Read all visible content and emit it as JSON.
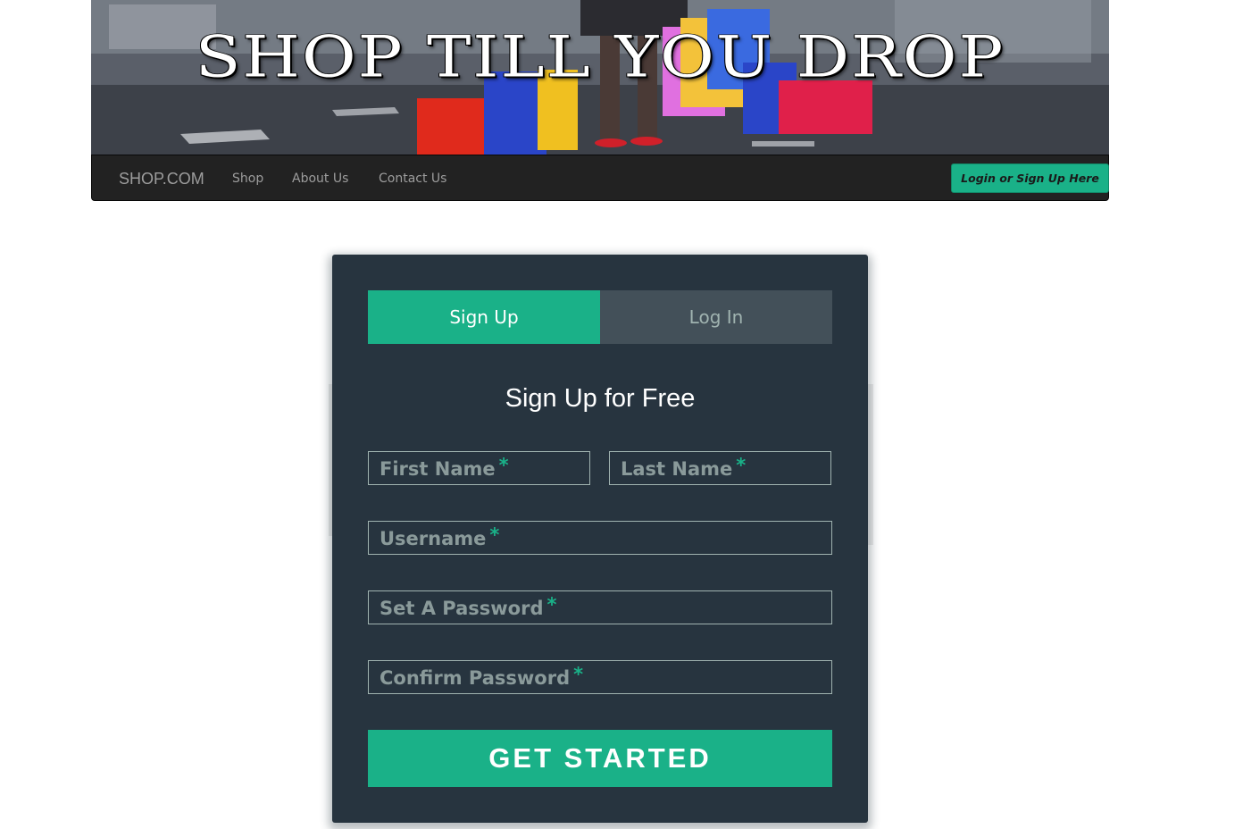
{
  "banner": {
    "title": "SHOP TILL YOU DROP"
  },
  "navbar": {
    "brand": "SHOP.COM",
    "links": [
      "Shop",
      "About Us",
      "Contact Us"
    ],
    "login_button": "Login or Sign Up Here"
  },
  "form": {
    "tabs": [
      {
        "label": "Sign Up",
        "active": true
      },
      {
        "label": "Log In",
        "active": false
      }
    ],
    "title": "Sign Up for Free",
    "required_marker": "*",
    "fields": {
      "first_name": "First Name",
      "last_name": "Last Name",
      "username": "Username",
      "password": "Set A Password",
      "confirm_password": "Confirm Password"
    },
    "submit_label": "GET STARTED"
  },
  "colors": {
    "accent": "#1ab188",
    "panel_bg": "#27343f",
    "inactive_tab": "#435059",
    "navbar_bg": "#222222",
    "nav_text": "#9d9d9d"
  }
}
